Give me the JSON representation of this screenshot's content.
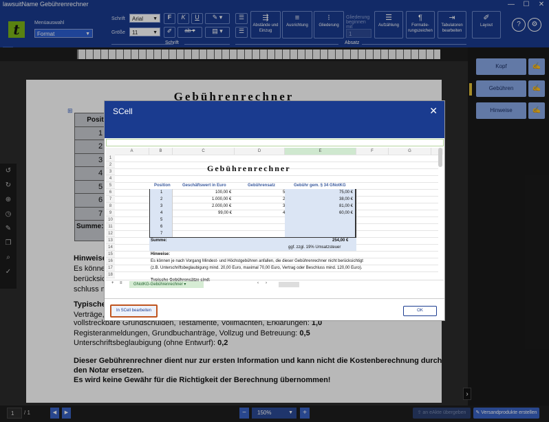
{
  "window": {
    "title": "lawsuitName Gebührenrechner",
    "minimize": "—",
    "maximize": "☐",
    "close": "✕"
  },
  "ribbon": {
    "logo": "t",
    "menu_label": "Menüauswahl",
    "menu_value": "Format",
    "font_label": "Schrift",
    "font_value": "Arial",
    "size_label": "Größe",
    "size_value": "11",
    "bold": "F",
    "italic": "K",
    "underline": "U",
    "strike": "ab",
    "indent_btn": "Abstände und Einzug",
    "align_btn": "Ausrichtung",
    "outline_btn": "Gliederung",
    "outline_start_label": "Gliederung beginnen mit",
    "outline_start_value": "1",
    "list_btn": "Aufzählung",
    "format_marks_btn": "Formatie-rungszeichen",
    "tab_btn": "Tabulatoren bearbeiten",
    "layout_btn": "Layout",
    "help": "?",
    "settings_icon": "gear-icon",
    "schrift_section": "Schrift",
    "absatz_section": "Absatz"
  },
  "document": {
    "title": "Gebührenrechner",
    "table_header": "Position",
    "table_rows": [
      "1",
      "2",
      "3",
      "4",
      "5",
      "6",
      "7"
    ],
    "sum_label": "Summe:",
    "hints_heading": "Hinweise:",
    "hints_lines": [
      "Es können je",
      "berücksich",
      "schluss m"
    ],
    "typical_heading": "Typische",
    "typical_lines": [
      "Verträge,",
      "vollstreckbare Grundschulden, Testamente, Vollmachten, Erklärungen: ",
      "Registeranmeldungen, Grundbuchanträge, Vollzug und Betreuung: ",
      "Unterschriftsbeglaubigung (ohne Entwurf): "
    ],
    "typical_values": [
      "1,0",
      "0,5",
      "0,2"
    ],
    "disclaimer_lines": [
      "Dieser Gebührenrechner dient nur zur ersten Information und kann nicht die Kostenberechnung durch",
      "den Notar ersetzen.",
      "Es wird keine Gewähr für die Richtigkeit der Berechnung übernommen!"
    ]
  },
  "right_panel": {
    "items": [
      "Kopf",
      "Gebühren",
      "Hinweise"
    ]
  },
  "bottom_bar": {
    "page_current": "1",
    "page_total": "/ 1",
    "zoom": "150%",
    "zoom_minus": "−",
    "zoom_plus": "+",
    "transfer_btn": "an eAkte übergeben",
    "shipping_btn": "Versandprodukte erstellen"
  },
  "dialog": {
    "title": "SCell",
    "close": "✕",
    "columns": [
      "A",
      "B",
      "C",
      "D",
      "E",
      "F",
      "G"
    ],
    "rows": [
      "1",
      "2",
      "3",
      "4",
      "5",
      "6",
      "7",
      "8",
      "9",
      "10",
      "11",
      "12",
      "13",
      "14",
      "15",
      "16",
      "17",
      "18"
    ],
    "sheet_title": "Gebührenrechner",
    "headers": [
      "Position",
      "Geschäftswert in Euro",
      "Gebührensatz",
      "Gebühr gem. § 34 GNotKG"
    ],
    "data_rows": [
      {
        "pos": "1",
        "value": "100,00 €",
        "rate": "5",
        "fee": "75,00 €"
      },
      {
        "pos": "2",
        "value": "1.000,00 €",
        "rate": "2",
        "fee": "38,00 €"
      },
      {
        "pos": "3",
        "value": "2.000,00 €",
        "rate": "3",
        "fee": "81,00 €"
      },
      {
        "pos": "4",
        "value": "99,00 €",
        "rate": "4",
        "fee": "60,00 €"
      },
      {
        "pos": "5",
        "value": "",
        "rate": "",
        "fee": ""
      },
      {
        "pos": "6",
        "value": "",
        "rate": "",
        "fee": ""
      },
      {
        "pos": "7",
        "value": "",
        "rate": "",
        "fee": ""
      }
    ],
    "sum_label": "Summe:",
    "sum_value": "254,00 €",
    "vat_note": "ggf. zzgl. 19% Umsatzsteuer",
    "hints_label": "Hinweise:",
    "hint_line1": "Es können je nach Vorgang Mindest- und Höchstgebühren anfallen, die dieser Gebührenrechner nicht berücksichtigt",
    "hint_line2": "(z.B. Unterschriftsbeglaubigung mind. 20,00 Euro, maximal 70,00 Euro, Vertrag oder Beschluss mind. 120,00 Euro).",
    "typical_label": "Typische Gebührensätze sind:",
    "sheet_tab": "GNotKG-Gebührenrechner",
    "edit_button": "In SCell bearbeiten",
    "ok_button": "OK"
  }
}
